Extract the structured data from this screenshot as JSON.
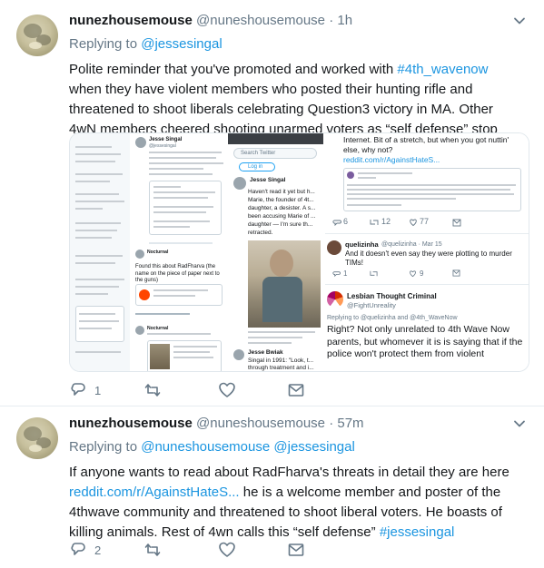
{
  "tweets": [
    {
      "name": "nunezhousemouse",
      "handle": "@nuneshousemouse",
      "separator": "·",
      "time": "1h",
      "replying_prefix": "Replying to",
      "replying_to": [
        "@jessesingal"
      ],
      "text_parts": [
        "Polite reminder that you've promoted and worked with ",
        "#4th_wavenow",
        " when they have violent members who posted their hunting rifle and threatened to shoot liberals celebrating Question3 victory in MA. Other 4wN members cheered shooting unarmed voters as “self defense” stop violence"
      ],
      "reply_count": "1",
      "retweet_count": "",
      "like_count": ""
    },
    {
      "name": "nunezhousemouse",
      "handle": "@nuneshousemouse",
      "separator": "·",
      "time": "57m",
      "replying_prefix": "Replying to",
      "replying_to": [
        "@nuneshousemouse",
        "@jessesingal"
      ],
      "text_parts": [
        "If anyone wants to read about RadFharva's threats in detail they are here ",
        "reddit.com/r/AgainstHateS...",
        " he is a welcome member and poster of the 4thwave community and threatened to shoot liberal voters. He boasts of killing animals. Rest of 4wn calls this “self defense” ",
        "#jessesingal"
      ],
      "reply_count": "2",
      "retweet_count": "",
      "like_count": ""
    }
  ],
  "media": {
    "panel2": {
      "author": "Jesse Singal",
      "author_handle": "@jessesingal",
      "second_author": "Nocturnal",
      "second_line": "Found this about RadFharva (the name on the piece of paper next to the guns)",
      "third_author": "Nocturnal"
    },
    "panel3": {
      "search_placeholder": "Search Twitter",
      "login_label": "Log in",
      "name": "Jesse Singal",
      "body": "Haven't read it yet but h... Marie, the founder of 4t... daughter, a desister. A s... been accusing Marie of ... daughter — I'm sure th... retracted.",
      "footer_name": "Jesse Bwiak",
      "footer_text": "Singal in 1991: \"Look, t... through treatment and i... tons of pressure from t..."
    },
    "panel4": {
      "top_text": "Internet. Bit of a stretch, but when you got nuttin' else, why not?",
      "top_link": "reddit.com/r/AgainstHateS...",
      "stats": [
        "6",
        "12",
        "77"
      ],
      "user2": "quelizinha",
      "user2_handle": "@quelizinha · Mar 15",
      "user2_text": "And it doesn't even say they were plotting to murder TIMs!",
      "user2_stats": [
        "1",
        "",
        "9"
      ],
      "user3": "Lesbian Thought Criminal",
      "user3_handle": "@FightUnreality",
      "user3_replying": "Replying to @quelizinha and @4th_WaveNow",
      "user3_text": "Right? Not only unrelated to 4th Wave Now parents, but whomever it is is saying that if the police won't protect them from violent"
    }
  },
  "colors": {
    "link": "#1b95e0",
    "secondary": "#657786",
    "primary_text": "#14171a",
    "border": "#e6ecf0"
  },
  "icons": [
    "chevron-down-icon",
    "reply-icon",
    "retweet-icon",
    "like-icon",
    "message-icon"
  ]
}
